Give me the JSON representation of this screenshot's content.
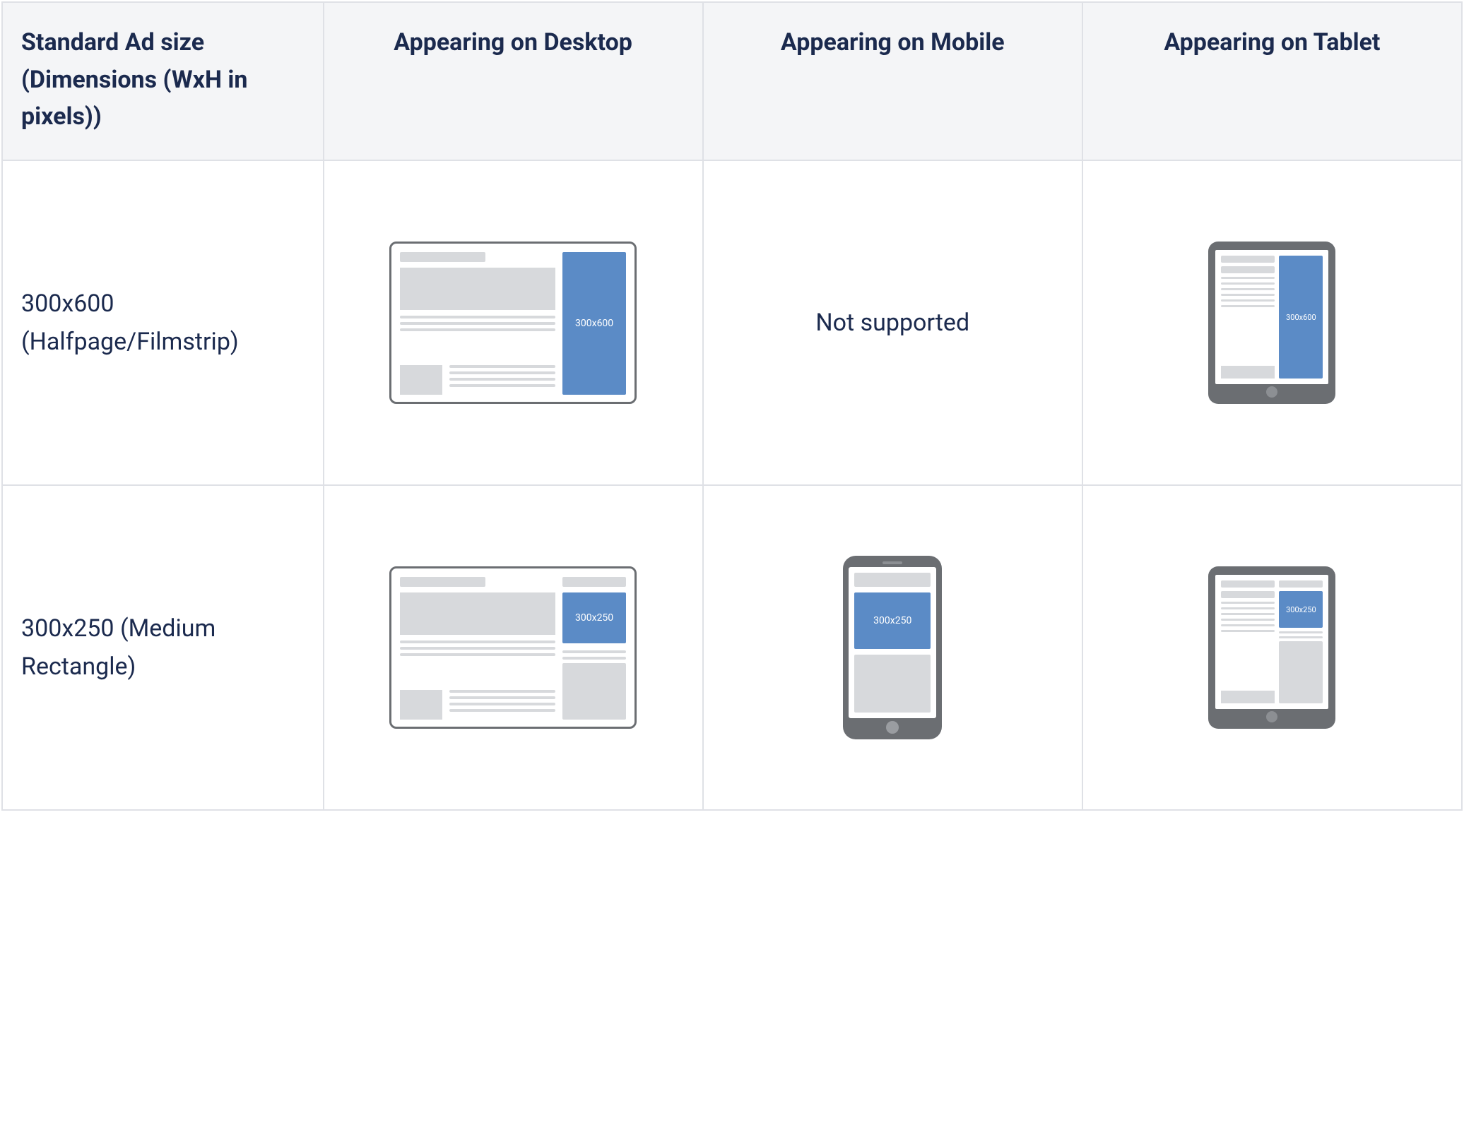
{
  "headers": {
    "col0": "Standard Ad size (Dimensions (WxH in pixels))",
    "col1": "Appearing on Desktop",
    "col2": "Appearing on Mobile",
    "col3": "Appearing on Tablet"
  },
  "rows": [
    {
      "name": "300x600 (Halfpage/Filmstrip)",
      "ad_label": "300x600",
      "desktop": {
        "supported": true,
        "layout": "half"
      },
      "mobile": {
        "supported": false,
        "text": "Not supported"
      },
      "tablet": {
        "supported": true,
        "layout": "half"
      }
    },
    {
      "name": "300x250 (Medium Rectangle)",
      "ad_label": "300x250",
      "desktop": {
        "supported": true,
        "layout": "mrec"
      },
      "mobile": {
        "supported": true,
        "layout": "mrec"
      },
      "tablet": {
        "supported": true,
        "layout": "mrec"
      }
    }
  ]
}
